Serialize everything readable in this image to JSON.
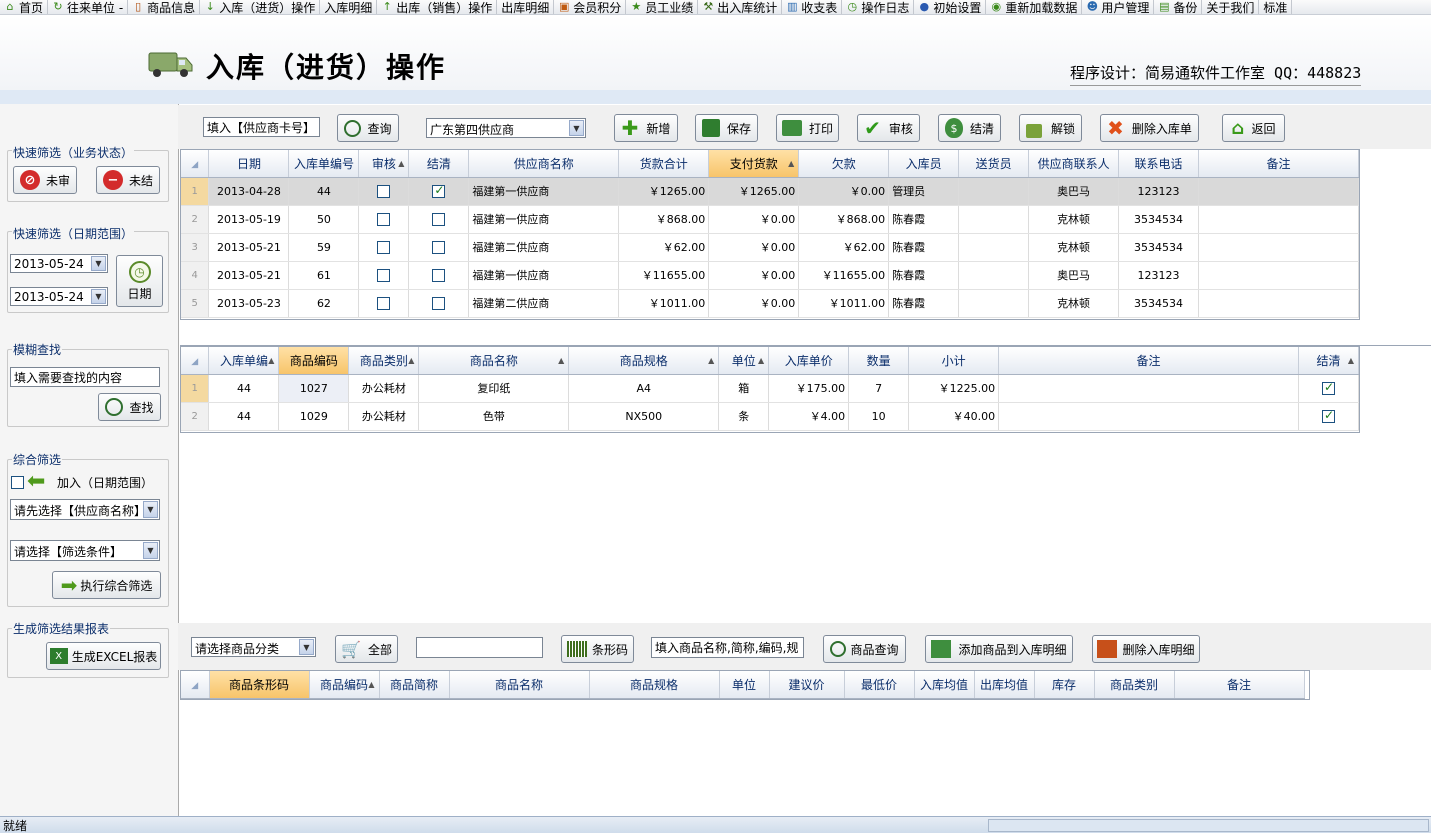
{
  "menubar": {
    "items": [
      {
        "label": "首页",
        "icon": "home-icon"
      },
      {
        "label": "往来单位 -",
        "icon": "refresh-icon"
      },
      {
        "label": "商品信息",
        "icon": "document-icon"
      },
      {
        "label": "入库（进货）操作",
        "icon": "arrow-down-icon"
      },
      {
        "label": "入库明细",
        "icon": ""
      },
      {
        "label": "出库（销售）操作",
        "icon": "arrow-up-icon"
      },
      {
        "label": "出库明细",
        "icon": ""
      },
      {
        "label": "会员积分",
        "icon": "gift-icon"
      },
      {
        "label": "员工业绩",
        "icon": "star-icon"
      },
      {
        "label": "出入库统计",
        "icon": "tool-icon"
      },
      {
        "label": "收支表",
        "icon": "bar-chart-icon"
      },
      {
        "label": "操作日志",
        "icon": "clock-icon"
      },
      {
        "label": "初始设置",
        "icon": "globe-icon"
      },
      {
        "label": "重新加载数据",
        "icon": "reload-icon"
      },
      {
        "label": "用户管理",
        "icon": "users-icon"
      },
      {
        "label": "备份",
        "icon": "save-icon"
      },
      {
        "label": "关于我们",
        "icon": ""
      },
      {
        "label": "标准",
        "icon": ""
      }
    ]
  },
  "header": {
    "title": "入库（进货）操作",
    "credit": "程序设计：简易通软件工作室 QQ：448823"
  },
  "left": {
    "status_filter": {
      "title": "快速筛选（业务状态）",
      "unreviewed": "未审",
      "unsettled": "未结"
    },
    "date_filter": {
      "title": "快速筛选（日期范围）",
      "from": "2013-05-24",
      "to": "2013-05-24",
      "button": "日期"
    },
    "fuzzy": {
      "title": "模糊查找",
      "placeholder": "填入需要查找的内容",
      "button": "查找"
    },
    "combined": {
      "title": "综合筛选",
      "add_label": "加入（日期范围）",
      "supplier_select": "请先选择【供应商名称】",
      "condition_select": "请选择【筛选条件】",
      "button": "执行综合筛选"
    },
    "report": {
      "title": "生成筛选结果报表",
      "button": "生成EXCEL报表"
    }
  },
  "toolbar": {
    "card_input": "填入【供应商卡号】",
    "query": "查询",
    "supplier": "广东第四供应商",
    "add": "新增",
    "save": "保存",
    "print": "打印",
    "review": "审核",
    "settle": "结清",
    "unlock": "解锁",
    "delete": "删除入库单",
    "back": "返回"
  },
  "orders": {
    "columns": [
      "日期",
      "入库单编号",
      "审核",
      "结清",
      "供应商名称",
      "货款合计",
      "支付货款",
      "欠款",
      "入库员",
      "送货员",
      "供应商联系人",
      "联系电话",
      "备注"
    ],
    "rows": [
      {
        "n": "1",
        "date": "2013-04-28",
        "no": "44",
        "reviewed": false,
        "settled": true,
        "supplier": "福建第一供应商",
        "total": "￥1265.00",
        "paid": "￥1265.00",
        "owed": "￥0.00",
        "clerk": "管理员",
        "deliver": "",
        "contact": "奥巴马",
        "phone": "123123",
        "note": ""
      },
      {
        "n": "2",
        "date": "2013-05-19",
        "no": "50",
        "reviewed": false,
        "settled": false,
        "supplier": "福建第一供应商",
        "total": "￥868.00",
        "paid": "￥0.00",
        "owed": "￥868.00",
        "clerk": "陈春霞",
        "deliver": "",
        "contact": "克林顿",
        "phone": "3534534",
        "note": ""
      },
      {
        "n": "3",
        "date": "2013-05-21",
        "no": "59",
        "reviewed": false,
        "settled": false,
        "supplier": "福建第二供应商",
        "total": "￥62.00",
        "paid": "￥0.00",
        "owed": "￥62.00",
        "clerk": "陈春霞",
        "deliver": "",
        "contact": "克林顿",
        "phone": "3534534",
        "note": ""
      },
      {
        "n": "4",
        "date": "2013-05-21",
        "no": "61",
        "reviewed": false,
        "settled": false,
        "supplier": "福建第一供应商",
        "total": "￥11655.00",
        "paid": "￥0.00",
        "owed": "￥11655.00",
        "clerk": "陈春霞",
        "deliver": "",
        "contact": "奥巴马",
        "phone": "123123",
        "note": ""
      },
      {
        "n": "5",
        "date": "2013-05-23",
        "no": "62",
        "reviewed": false,
        "settled": false,
        "supplier": "福建第二供应商",
        "total": "￥1011.00",
        "paid": "￥0.00",
        "owed": "￥1011.00",
        "clerk": "陈春霞",
        "deliver": "",
        "contact": "克林顿",
        "phone": "3534534",
        "note": ""
      }
    ]
  },
  "details": {
    "columns": [
      "入库单编",
      "商品编码",
      "商品类别",
      "商品名称",
      "商品规格",
      "单位",
      "入库单价",
      "数量",
      "小计",
      "备注",
      "结清"
    ],
    "rows": [
      {
        "n": "1",
        "order": "44",
        "code": "1027",
        "category": "办公耗材",
        "name": "复印纸",
        "spec": "A4",
        "unit": "箱",
        "price": "￥175.00",
        "qty": "7",
        "subtotal": "￥1225.00",
        "note": "",
        "settled": true
      },
      {
        "n": "2",
        "order": "44",
        "code": "1029",
        "category": "办公耗材",
        "name": "色带",
        "spec": "NX500",
        "unit": "条",
        "price": "￥4.00",
        "qty": "10",
        "subtotal": "￥40.00",
        "note": "",
        "settled": true
      }
    ]
  },
  "product_bar": {
    "category_select": "请选择商品分类",
    "all": "全部",
    "barcode_value": "",
    "barcode_button": "条形码",
    "search_input": "填入商品名称,简称,编码,规",
    "search_button": "商品查询",
    "add_button": "添加商品到入库明细",
    "delete_button": "删除入库明细"
  },
  "products": {
    "columns": [
      "商品条形码",
      "商品编码",
      "商品简称",
      "商品名称",
      "商品规格",
      "单位",
      "建议价",
      "最低价",
      "入库均值",
      "出库均值",
      "库存",
      "商品类别",
      "备注"
    ]
  },
  "status": {
    "text": "就绪"
  }
}
